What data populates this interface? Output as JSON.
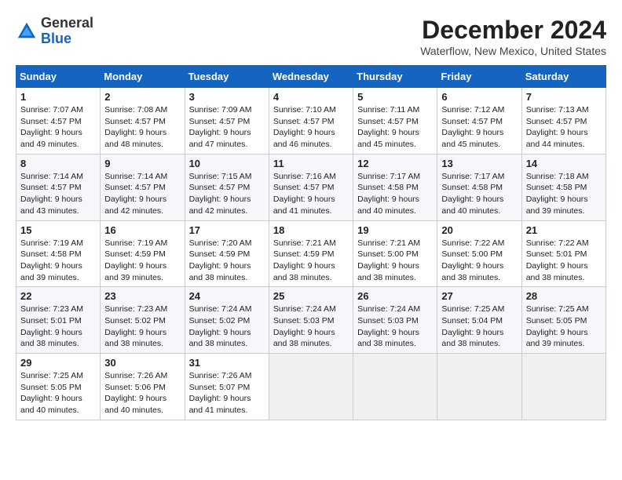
{
  "header": {
    "logo_general": "General",
    "logo_blue": "Blue",
    "title": "December 2024",
    "location": "Waterflow, New Mexico, United States"
  },
  "weekdays": [
    "Sunday",
    "Monday",
    "Tuesday",
    "Wednesday",
    "Thursday",
    "Friday",
    "Saturday"
  ],
  "weeks": [
    [
      {
        "day": "1",
        "sunrise": "7:07 AM",
        "sunset": "4:57 PM",
        "daylight": "9 hours and 49 minutes."
      },
      {
        "day": "2",
        "sunrise": "7:08 AM",
        "sunset": "4:57 PM",
        "daylight": "9 hours and 48 minutes."
      },
      {
        "day": "3",
        "sunrise": "7:09 AM",
        "sunset": "4:57 PM",
        "daylight": "9 hours and 47 minutes."
      },
      {
        "day": "4",
        "sunrise": "7:10 AM",
        "sunset": "4:57 PM",
        "daylight": "9 hours and 46 minutes."
      },
      {
        "day": "5",
        "sunrise": "7:11 AM",
        "sunset": "4:57 PM",
        "daylight": "9 hours and 45 minutes."
      },
      {
        "day": "6",
        "sunrise": "7:12 AM",
        "sunset": "4:57 PM",
        "daylight": "9 hours and 45 minutes."
      },
      {
        "day": "7",
        "sunrise": "7:13 AM",
        "sunset": "4:57 PM",
        "daylight": "9 hours and 44 minutes."
      }
    ],
    [
      {
        "day": "8",
        "sunrise": "7:14 AM",
        "sunset": "4:57 PM",
        "daylight": "9 hours and 43 minutes."
      },
      {
        "day": "9",
        "sunrise": "7:14 AM",
        "sunset": "4:57 PM",
        "daylight": "9 hours and 42 minutes."
      },
      {
        "day": "10",
        "sunrise": "7:15 AM",
        "sunset": "4:57 PM",
        "daylight": "9 hours and 42 minutes."
      },
      {
        "day": "11",
        "sunrise": "7:16 AM",
        "sunset": "4:57 PM",
        "daylight": "9 hours and 41 minutes."
      },
      {
        "day": "12",
        "sunrise": "7:17 AM",
        "sunset": "4:58 PM",
        "daylight": "9 hours and 40 minutes."
      },
      {
        "day": "13",
        "sunrise": "7:17 AM",
        "sunset": "4:58 PM",
        "daylight": "9 hours and 40 minutes."
      },
      {
        "day": "14",
        "sunrise": "7:18 AM",
        "sunset": "4:58 PM",
        "daylight": "9 hours and 39 minutes."
      }
    ],
    [
      {
        "day": "15",
        "sunrise": "7:19 AM",
        "sunset": "4:58 PM",
        "daylight": "9 hours and 39 minutes."
      },
      {
        "day": "16",
        "sunrise": "7:19 AM",
        "sunset": "4:59 PM",
        "daylight": "9 hours and 39 minutes."
      },
      {
        "day": "17",
        "sunrise": "7:20 AM",
        "sunset": "4:59 PM",
        "daylight": "9 hours and 38 minutes."
      },
      {
        "day": "18",
        "sunrise": "7:21 AM",
        "sunset": "4:59 PM",
        "daylight": "9 hours and 38 minutes."
      },
      {
        "day": "19",
        "sunrise": "7:21 AM",
        "sunset": "5:00 PM",
        "daylight": "9 hours and 38 minutes."
      },
      {
        "day": "20",
        "sunrise": "7:22 AM",
        "sunset": "5:00 PM",
        "daylight": "9 hours and 38 minutes."
      },
      {
        "day": "21",
        "sunrise": "7:22 AM",
        "sunset": "5:01 PM",
        "daylight": "9 hours and 38 minutes."
      }
    ],
    [
      {
        "day": "22",
        "sunrise": "7:23 AM",
        "sunset": "5:01 PM",
        "daylight": "9 hours and 38 minutes."
      },
      {
        "day": "23",
        "sunrise": "7:23 AM",
        "sunset": "5:02 PM",
        "daylight": "9 hours and 38 minutes."
      },
      {
        "day": "24",
        "sunrise": "7:24 AM",
        "sunset": "5:02 PM",
        "daylight": "9 hours and 38 minutes."
      },
      {
        "day": "25",
        "sunrise": "7:24 AM",
        "sunset": "5:03 PM",
        "daylight": "9 hours and 38 minutes."
      },
      {
        "day": "26",
        "sunrise": "7:24 AM",
        "sunset": "5:03 PM",
        "daylight": "9 hours and 38 minutes."
      },
      {
        "day": "27",
        "sunrise": "7:25 AM",
        "sunset": "5:04 PM",
        "daylight": "9 hours and 38 minutes."
      },
      {
        "day": "28",
        "sunrise": "7:25 AM",
        "sunset": "5:05 PM",
        "daylight": "9 hours and 39 minutes."
      }
    ],
    [
      {
        "day": "29",
        "sunrise": "7:25 AM",
        "sunset": "5:05 PM",
        "daylight": "9 hours and 40 minutes."
      },
      {
        "day": "30",
        "sunrise": "7:26 AM",
        "sunset": "5:06 PM",
        "daylight": "9 hours and 40 minutes."
      },
      {
        "day": "31",
        "sunrise": "7:26 AM",
        "sunset": "5:07 PM",
        "daylight": "9 hours and 41 minutes."
      },
      null,
      null,
      null,
      null
    ]
  ]
}
